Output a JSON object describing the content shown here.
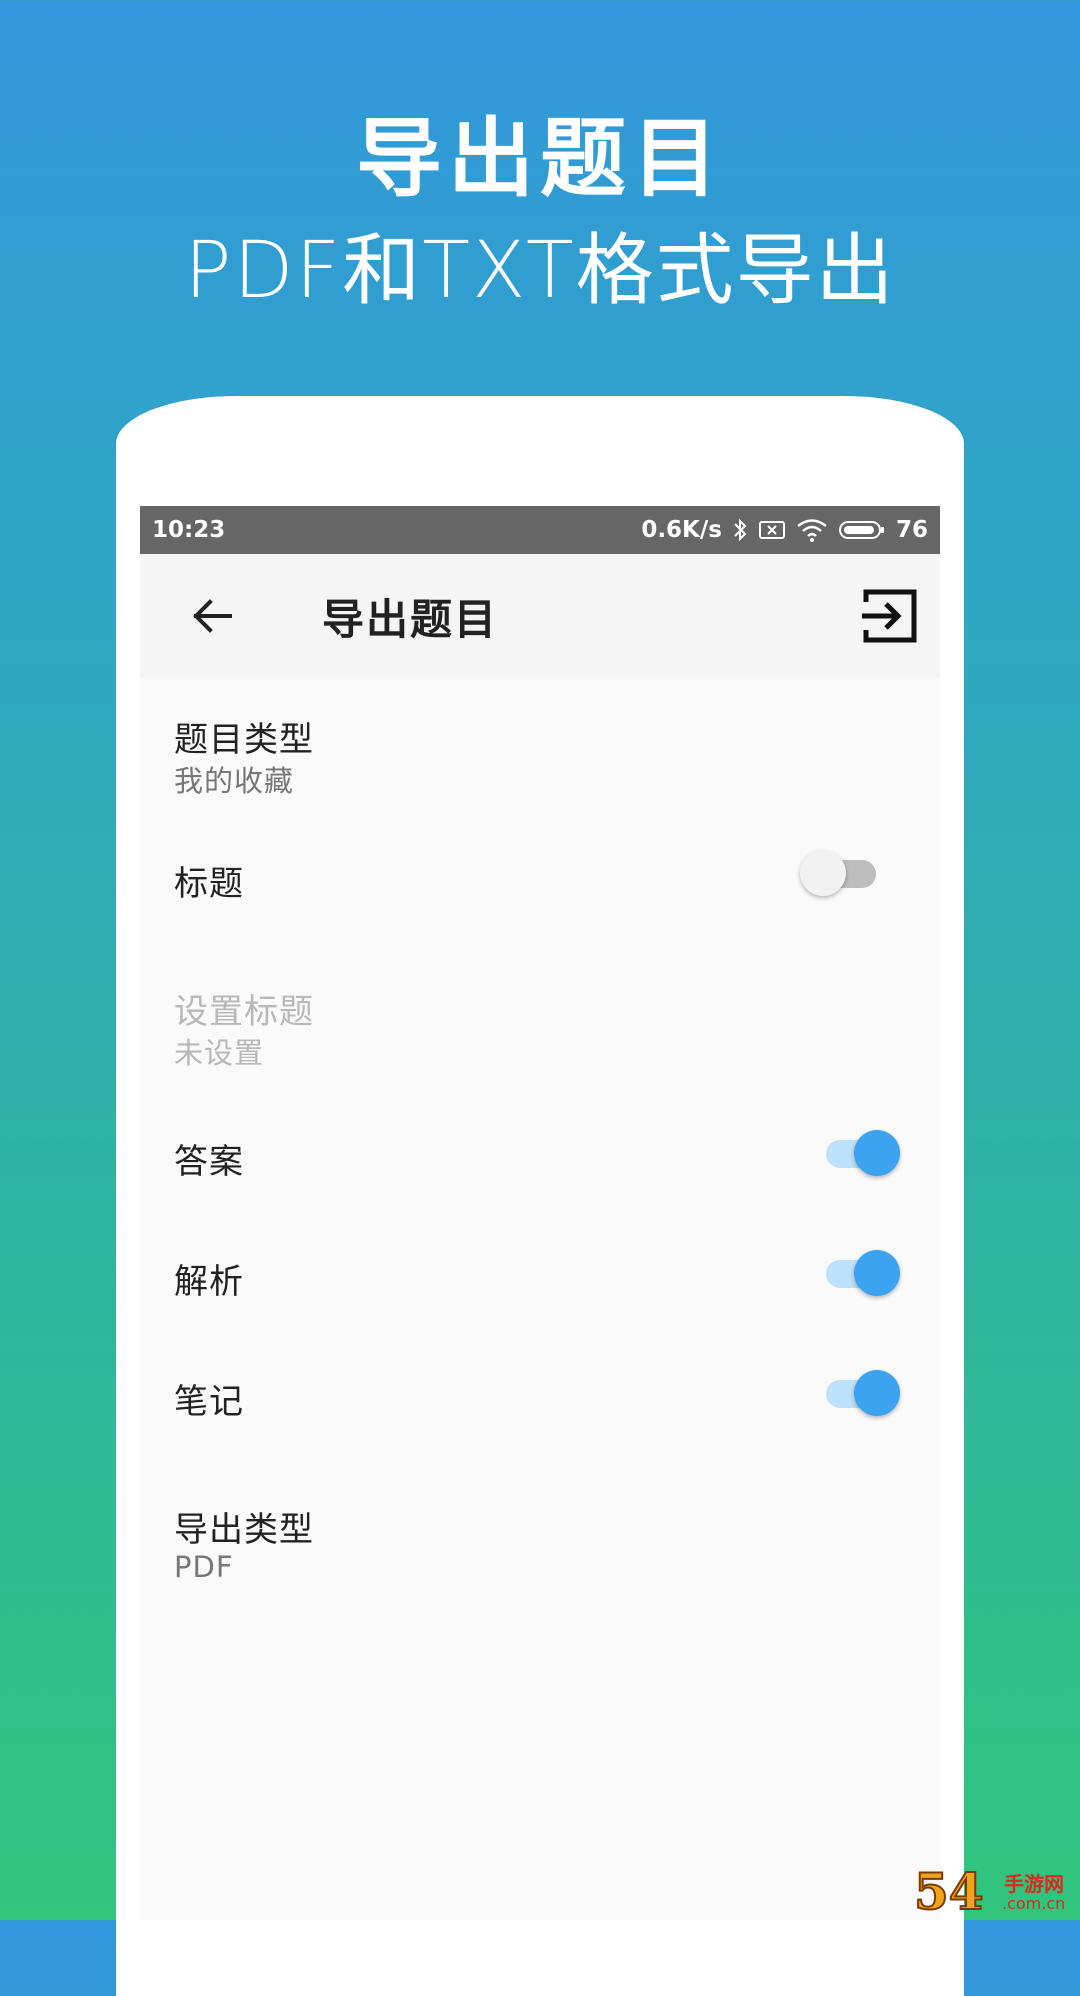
{
  "promo": {
    "title": "导出题目",
    "subtitle": "PDF和TXT格式导出"
  },
  "status_bar": {
    "time": "10:23",
    "net_speed": "0.6K/s",
    "battery": "76"
  },
  "app_bar": {
    "title": "导出题目",
    "back_icon": "arrow-left-icon",
    "action_icon": "export-icon"
  },
  "settings": {
    "question_type": {
      "label": "题目类型",
      "value": "我的收藏"
    },
    "title_toggle": {
      "label": "标题",
      "checked": false
    },
    "set_title": {
      "label": "设置标题",
      "value": "未设置"
    },
    "answer": {
      "label": "答案",
      "checked": true
    },
    "analysis": {
      "label": "解析",
      "checked": true
    },
    "notes": {
      "label": "笔记",
      "checked": true
    },
    "export_type": {
      "label": "导出类型",
      "value": "PDF"
    }
  },
  "watermark": {
    "logo_text": "54",
    "name": "手游网",
    "url": ".com.cn"
  },
  "colors": {
    "accent": "#3ba3f0",
    "gradient_top": "#3297dc",
    "gradient_bottom": "#31c57d"
  }
}
